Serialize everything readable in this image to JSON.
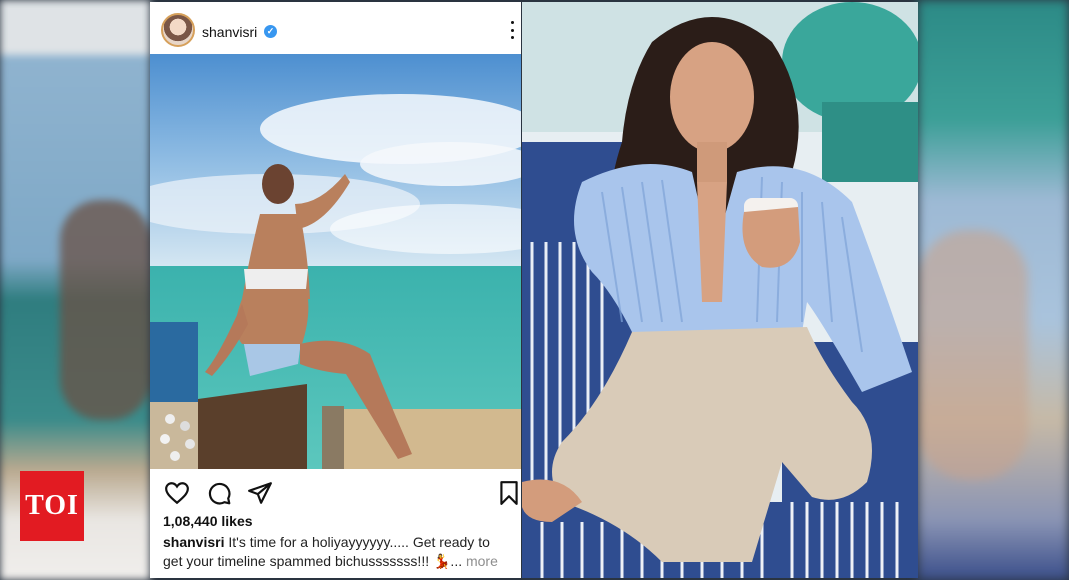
{
  "post": {
    "username": "shanvisri",
    "verified_badge": "✓",
    "likes": "1,08,440 likes",
    "caption_user": "shanvisri",
    "caption_text": "It's time for a holiyayyyyyy..... Get ready to get your timeline spammed bichusssssss!!! 💃...",
    "more_label": "more"
  },
  "icons": {
    "like": "heart-icon",
    "comment": "comment-icon",
    "share": "send-icon",
    "save": "bookmark-icon",
    "options": "more-options-icon"
  },
  "logo": {
    "text": "TOI",
    "color": "#e21b22"
  },
  "colors": {
    "verified": "#3897f0",
    "card_bg": "#ffffff"
  }
}
